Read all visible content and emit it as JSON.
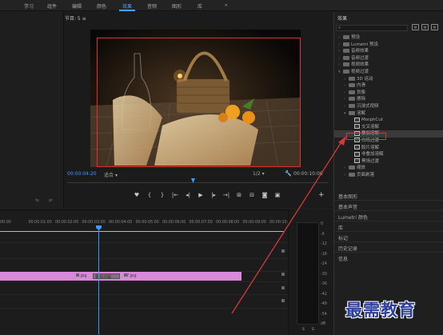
{
  "workspace_tabs": [
    {
      "label": "学习"
    },
    {
      "label": "组件"
    },
    {
      "label": "编辑"
    },
    {
      "label": "颜色"
    },
    {
      "label": "效果",
      "active": true
    },
    {
      "label": "音频"
    },
    {
      "label": "图形"
    },
    {
      "label": "库"
    },
    {
      "label": "»"
    }
  ],
  "program_monitor": {
    "title": "节目: 5  ≡",
    "timecode_current": "00:00:04:20",
    "fit_label": "适合",
    "ratio_label": "1/2",
    "timecode_duration": "00:00:10:00"
  },
  "effects_panel": {
    "title": "效果",
    "tree": [
      {
        "label": "预设",
        "kind": "folder",
        "indent": 1
      },
      {
        "label": "Lumetri 预设",
        "kind": "folder",
        "indent": 1
      },
      {
        "label": "音频效果",
        "kind": "folder",
        "indent": 1
      },
      {
        "label": "音频过渡",
        "kind": "folder",
        "indent": 1
      },
      {
        "label": "视频效果",
        "kind": "folder",
        "indent": 1
      },
      {
        "label": "视频过渡",
        "kind": "folder",
        "indent": 1,
        "expanded": true
      },
      {
        "label": "3D 运动",
        "kind": "folder",
        "indent": 2
      },
      {
        "label": "内滑",
        "kind": "folder",
        "indent": 2
      },
      {
        "label": "划像",
        "kind": "folder",
        "indent": 2
      },
      {
        "label": "擦除",
        "kind": "folder",
        "indent": 2
      },
      {
        "label": "沉浸式视频",
        "kind": "folder",
        "indent": 2
      },
      {
        "label": "溶解",
        "kind": "folder",
        "indent": 2,
        "expanded": true
      },
      {
        "label": "MorphCut",
        "kind": "fx",
        "indent": 3
      },
      {
        "label": "交叉溶解",
        "kind": "fx",
        "indent": 3
      },
      {
        "label": "叠加溶解",
        "kind": "fx",
        "indent": 3,
        "selected": true
      },
      {
        "label": "白场过渡",
        "kind": "fx",
        "indent": 3
      },
      {
        "label": "胶片溶解",
        "kind": "fx",
        "indent": 3
      },
      {
        "label": "非叠加溶解",
        "kind": "fx",
        "indent": 3
      },
      {
        "label": "黑场过渡",
        "kind": "fx",
        "indent": 3
      },
      {
        "label": "缩放",
        "kind": "folder",
        "indent": 2
      },
      {
        "label": "页面剥落",
        "kind": "folder",
        "indent": 2
      }
    ]
  },
  "side_panels": [
    {
      "label": "基本图形"
    },
    {
      "label": "基本声音"
    },
    {
      "label": "Lumetri 颜色"
    },
    {
      "label": "库"
    },
    {
      "label": "标记"
    },
    {
      "label": "历史记录"
    },
    {
      "label": "信息"
    }
  ],
  "timeline": {
    "ruler": [
      "00:00",
      "00:00:01:00",
      "00:00:02:00",
      "00:00:03:00",
      "00:00:04:00",
      "00:00:05:00",
      "00:00:06:00",
      "00:00:07:00",
      "00:00:08:00",
      "00:00:09:00",
      "00:00:10:00",
      "00:00:11:00"
    ],
    "clip_a": "1.jpg",
    "clip_fx": "叠加溶解",
    "clip_b": "7.jpg"
  },
  "audio_meter": {
    "ticks": [
      "0",
      "-6",
      "-12",
      "-18",
      "-24",
      "-30",
      "-36",
      "-42",
      "-48",
      "-54",
      "dB"
    ],
    "solo_labels": [
      "S",
      "S"
    ]
  },
  "watermark": "最需教育",
  "colors": {
    "accent": "#3d9bff",
    "highlight_red": "#e03030",
    "clip_pink": "#d88ad8",
    "work_area_yellow": "#d4c42a"
  }
}
